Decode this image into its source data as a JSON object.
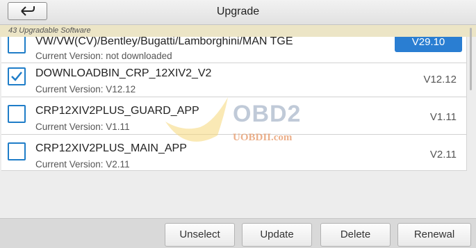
{
  "header": {
    "title": "Upgrade",
    "back_icon": "back-arrow-icon"
  },
  "subheader": {
    "text": "43 Upgradable Software"
  },
  "list": [
    {
      "name": "VW/VW(CV)/Bentley/Bugatti/Lamborghini/MAN TGE",
      "current": "Current Version: not downloaded",
      "version": "V29.10",
      "checked": false
    },
    {
      "name": "DOWNLOADBIN_CRP_12XIV2_V2",
      "current": "Current Version: V12.12",
      "version": "V12.12",
      "checked": true
    },
    {
      "name": "CRP12XIV2PLUS_GUARD_APP",
      "current": "Current Version: V1.11",
      "version": "V1.11",
      "checked": false
    },
    {
      "name": "CRP12XIV2PLUS_MAIN_APP",
      "current": "Current Version: V2.11",
      "version": "V2.11",
      "checked": false
    }
  ],
  "watermark": {
    "brand": "OBD2",
    "site": "UOBDII.com"
  },
  "footer": {
    "unselect": "Unselect",
    "update": "Update",
    "delete": "Delete",
    "renewal": "Renewal"
  },
  "colors": {
    "accent": "#1f7dc8",
    "subheader_bg": "#ece5c6"
  }
}
